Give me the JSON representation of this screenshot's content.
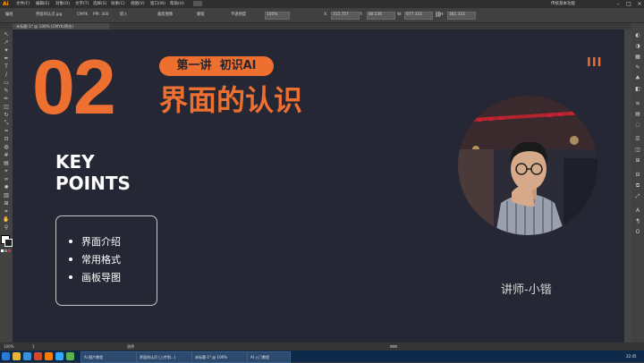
{
  "app": {
    "logo": "Ai"
  },
  "menu": {
    "items": [
      "文件(F)",
      "编辑(E)",
      "对象(O)",
      "文字(T)",
      "选择(S)",
      "效果(C)",
      "视图(V)",
      "窗口(W)",
      "帮助(H)"
    ],
    "workspace": "传统基本功能"
  },
  "control_bar": {
    "object_label": "编组",
    "doc_name": "界面的认识.jpg",
    "color_mode": "CMYK",
    "ppi": "PPI: 300",
    "embed": "嵌入",
    "crop": "裁剪图像",
    "mask": "蒙版",
    "opacity_label": "不透明度",
    "opacity": "100%",
    "x": "315.757",
    "y": "88.536",
    "w": "677.333",
    "h": "381.333"
  },
  "document": {
    "tab_label": "未标题-1* @ 100% (CMYK/预览)"
  },
  "slide": {
    "number": "02",
    "pill": "第一讲  初识AI",
    "title": "界面的认识",
    "decoration": "III",
    "key_line1": "KEY",
    "key_line2": "POINTS",
    "bullets": [
      "界面介绍",
      "常用格式",
      "画板导图"
    ],
    "teacher": "讲师-小锴"
  },
  "status_bar": {
    "zoom": "100%",
    "page": "1",
    "tool": "选择"
  },
  "taskbar": {
    "items": [
      "Ai 图片教程",
      "界面的认识 (上传到...)",
      "未标题-1* @ 100%",
      "AI 入门教程"
    ],
    "clock": "22:45"
  },
  "colors": {
    "accent": "#ee7031",
    "artboard_bg": "#252734",
    "app_bg": "#3b3b3b"
  }
}
